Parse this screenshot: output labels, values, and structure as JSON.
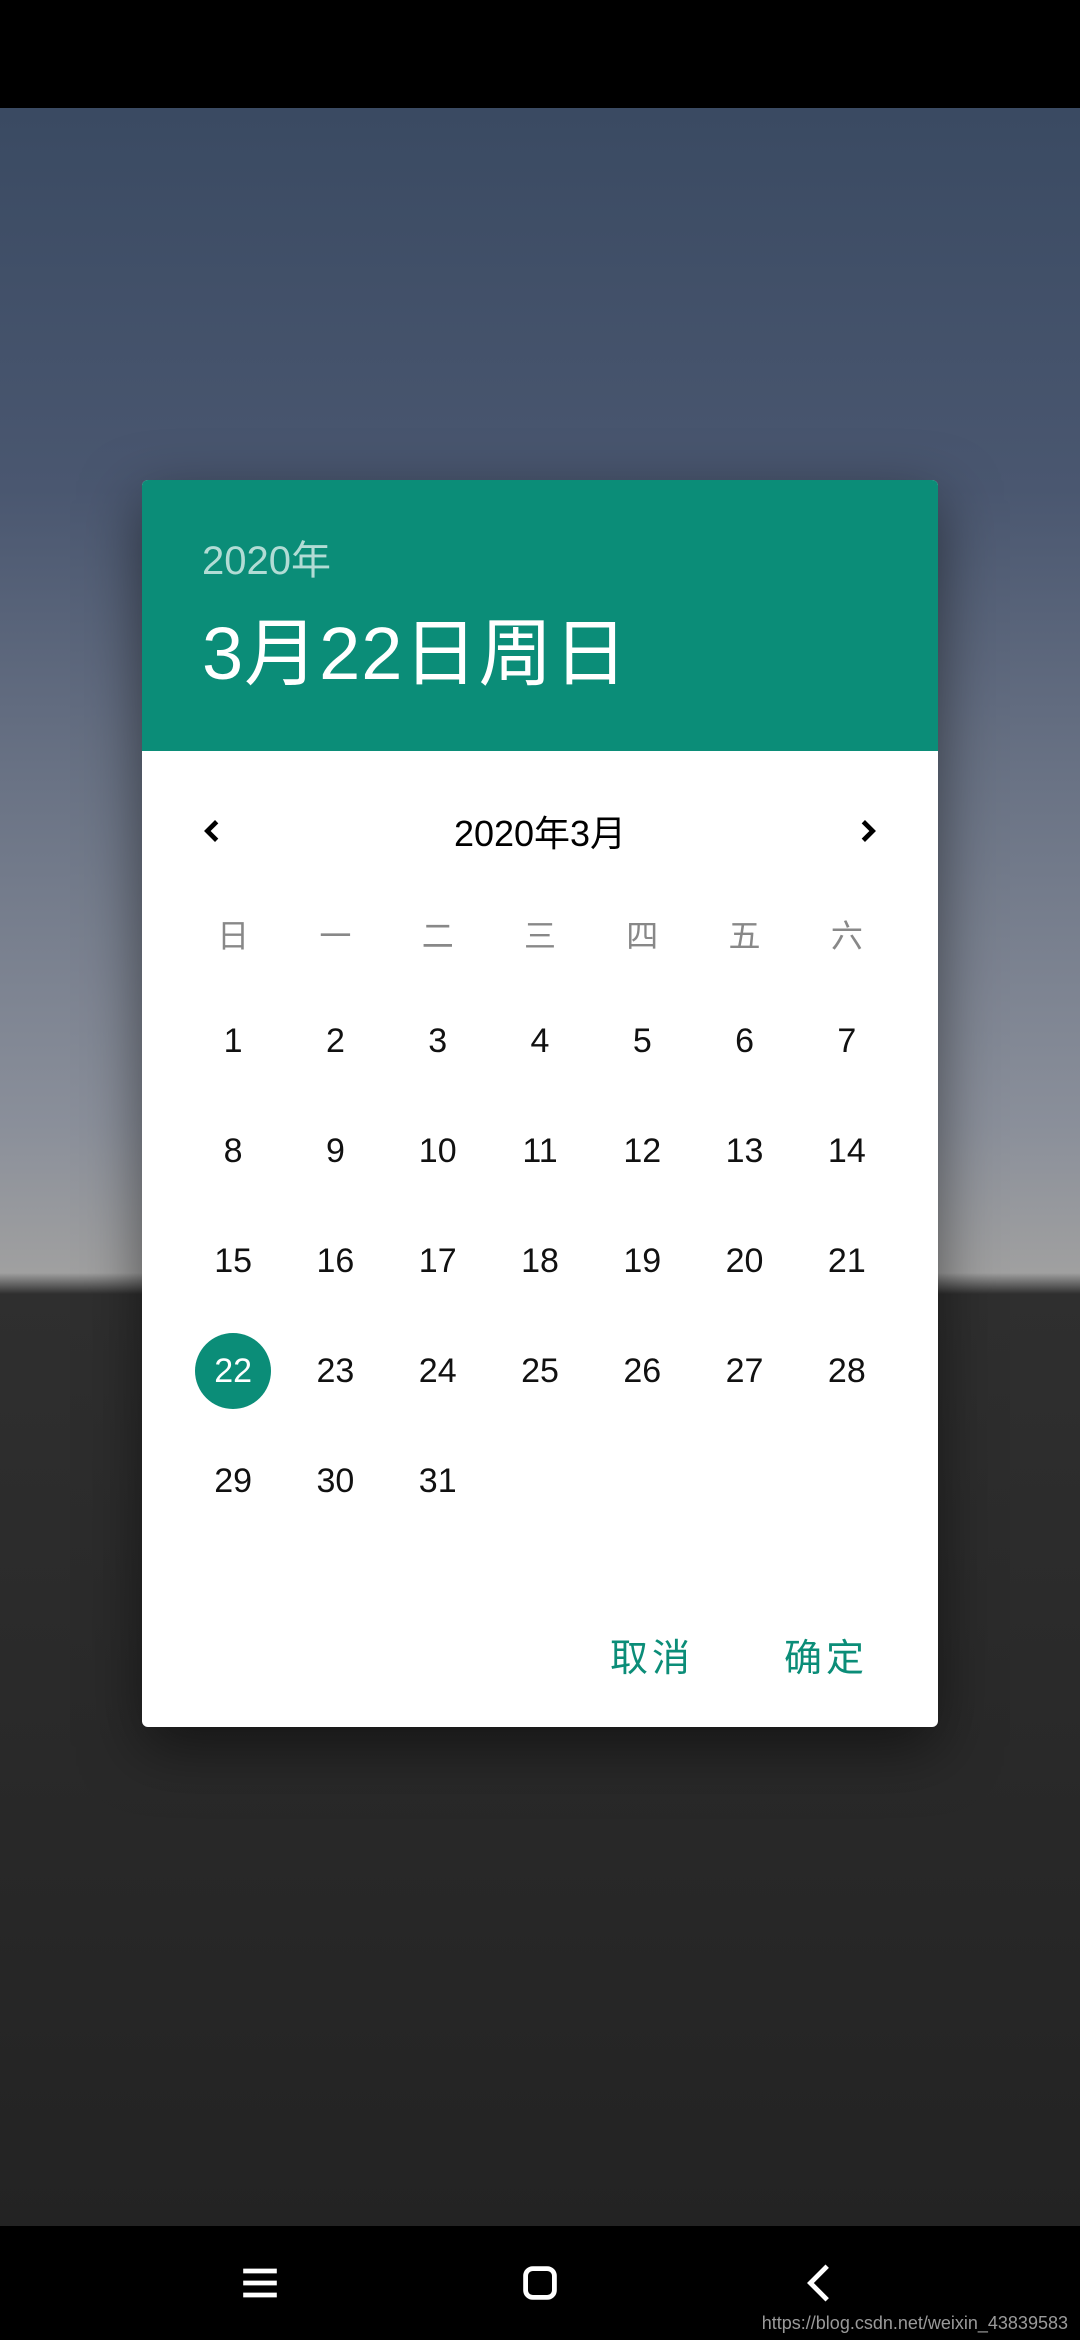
{
  "colors": {
    "accent": "#0b8d78"
  },
  "header": {
    "year": "2020年",
    "date": "3月22日周日"
  },
  "month": {
    "label": "2020年3月",
    "prev_icon": "chevron-left",
    "next_icon": "chevron-right"
  },
  "weekdays": [
    "日",
    "一",
    "二",
    "三",
    "四",
    "五",
    "六"
  ],
  "days": [
    "1",
    "2",
    "3",
    "4",
    "5",
    "6",
    "7",
    "8",
    "9",
    "10",
    "11",
    "12",
    "13",
    "14",
    "15",
    "16",
    "17",
    "18",
    "19",
    "20",
    "21",
    "22",
    "23",
    "24",
    "25",
    "26",
    "27",
    "28",
    "29",
    "30",
    "31"
  ],
  "selected_day": "22",
  "actions": {
    "cancel": "取消",
    "confirm": "确定"
  },
  "navbar": {
    "menu": "menu-icon",
    "home": "square-icon",
    "back": "back-icon"
  },
  "watermark": "https://blog.csdn.net/weixin_43839583"
}
